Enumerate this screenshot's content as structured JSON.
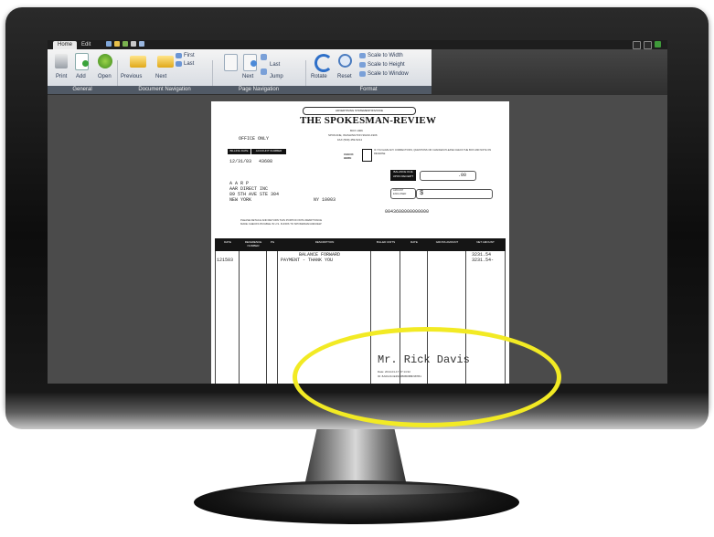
{
  "app": {
    "tabs": [
      {
        "label": "Home"
      },
      {
        "label": "Edit"
      }
    ],
    "groups": [
      {
        "label": "General"
      },
      {
        "label": "Document Navigation"
      },
      {
        "label": "Page Navigation"
      },
      {
        "label": "Format"
      }
    ],
    "buttons": {
      "print": "Print",
      "add": "Add",
      "open": "Open",
      "previous": "Previous",
      "next": "Next",
      "first": "First",
      "last": "Last",
      "page_next": "Next",
      "page_last": "Last",
      "jump": "Jump",
      "rotate": "Rotate",
      "reset": "Reset",
      "scale_width": "Scale to Width",
      "scale_height": "Scale to Height",
      "scale_window": "Scale to Window"
    }
  },
  "invoice": {
    "statement_label": "ADVERTISING STATEMENT/INVOICE",
    "masthead": "THE SPOKESMAN-REVIEW",
    "address_1": "BOX 1906",
    "address_2": "SPOKANE, WASHINGTON 99210-1906",
    "fax": "FAX (509) 459-5214",
    "office_only": "OFFICE ONLY",
    "billing_date_label": "BILLING DATE",
    "account_number_label": "ACCOUNT NUMBER",
    "billing_date": "12/31/03",
    "account_number": "43608",
    "check_here": "CHECK HERE",
    "check_note": "IF YOU HAVE ANY CORRECTIONS, QUESTIONS OR CHANGES PLEASE CHECK THE BOX AND NOTE ON REVERSE",
    "balance_due_label": "BALANCE DUE UPON RECEIPT",
    "balance_due": ".00",
    "amount_enclosed_label": "AMOUNT ENCLOSED",
    "amount_prefix": "$",
    "address_lines": [
      "A A R P",
      "AAR DIRECT INC",
      "89 5TH AVE STE 304",
      "NEW YORK"
    ],
    "state_zip": "NY 10003",
    "barcode": "0043608000000000",
    "detach_note_1": "PLEASE DETACH AND RETURN THIS PORTION WITH REMITTANCE",
    "detach_note_2": "MAKE CHECKS PAYABLE IN U.S. FUNDS TO SPOKESMAN-REVIEW",
    "columns": [
      "DATE",
      "REFERENCE NUMBER",
      "PG",
      "DESCRIPTION",
      "BILLED UNITS",
      "RATE",
      "GROSS AMOUNT",
      "NET AMOUNT"
    ],
    "rows": [
      {
        "date": "",
        "description": "BALANCE FORWARD",
        "net": "3231.54"
      },
      {
        "date": "121503",
        "description": "PAYMENT - THANK YOU",
        "net": "3231.54-"
      }
    ],
    "signature_name": "Mr. Rick Davis",
    "signature_meta_1": "Date: 2014-01-17 07:14:32",
    "signature_meta_2": "ID: 8A0C21CE3940B6B0B8F987B1"
  },
  "colors": {
    "highlight_ellipse": "#f2ea24",
    "ribbon_group_bar": "#515a66",
    "viewer_background": "#4b4b4b"
  }
}
